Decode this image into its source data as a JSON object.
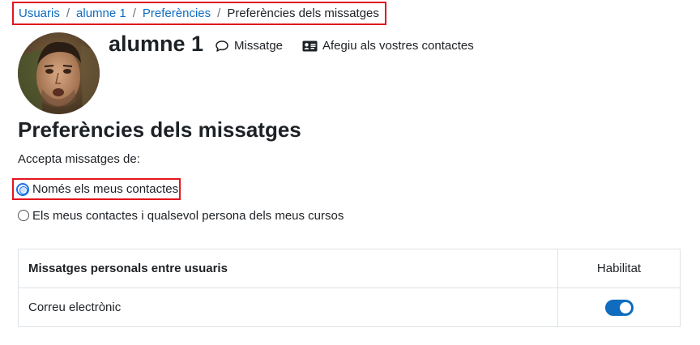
{
  "breadcrumb": {
    "items": [
      "Usuaris",
      "alumne 1",
      "Preferències"
    ],
    "separator": "/",
    "current": "Preferències dels missatges"
  },
  "user": {
    "name": "alumne 1"
  },
  "actions": {
    "message_label": "Missatge",
    "message_icon": "speech-bubble-icon",
    "add_contact_label": "Afegiu als vostres contactes",
    "add_contact_icon": "address-card-icon"
  },
  "preferences": {
    "title": "Preferències dels missatges",
    "accept_label": "Accepta missatges de:",
    "options": [
      "Només els meus contactes",
      "Els meus contactes i qualsevol persona dels meus cursos"
    ]
  },
  "table": {
    "header_left": "Missatges personals entre usuaris",
    "header_right": "Habilitat",
    "rows": [
      {
        "label": "Correu electrònic",
        "enabled": true
      }
    ]
  },
  "colors": {
    "link": "#0f6cbf",
    "highlight_border": "#e2161f",
    "toggle_on": "#0f6cbf"
  }
}
